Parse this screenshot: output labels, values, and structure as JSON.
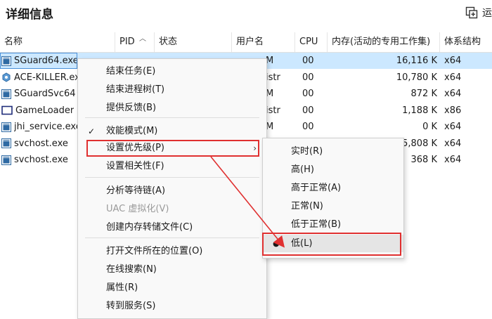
{
  "header": {
    "title": "详细信息",
    "run_label": "运"
  },
  "columns": [
    "名称",
    "PID",
    "状态",
    "用户名",
    "CPU",
    "内存(活动的专用工作集)",
    "体系结构"
  ],
  "rows": [
    {
      "name": "SGuard64.exe",
      "user": "M",
      "cpu": "00",
      "mem": "16,116 K",
      "arch": "x64",
      "icon": "app-window-icon",
      "selected": true
    },
    {
      "name": "ACE-KILLER.exe",
      "user": "istr",
      "cpu": "00",
      "mem": "10,780 K",
      "arch": "x64",
      "icon": "gear-app-icon"
    },
    {
      "name": "SGuardSvc64",
      "user": "M",
      "cpu": "00",
      "mem": "872 K",
      "arch": "x64",
      "icon": "app-window-icon"
    },
    {
      "name": "GameLoader",
      "user": "istr",
      "cpu": "00",
      "mem": "1,188 K",
      "arch": "x86",
      "icon": "window-frame-icon"
    },
    {
      "name": "jhi_service.exe",
      "user": "M",
      "cpu": "00",
      "mem": "0 K",
      "arch": "x64",
      "icon": "app-window-icon"
    },
    {
      "name": "svchost.exe",
      "user": "",
      "cpu": "",
      "mem": "5,808 K",
      "arch": "x64",
      "icon": "app-window-icon"
    },
    {
      "name": "svchost.exe",
      "user": "",
      "cpu": "",
      "mem": "368 K",
      "arch": "x64",
      "icon": "app-window-icon"
    }
  ],
  "context_menu": {
    "items": [
      {
        "label": "结束任务(E)"
      },
      {
        "label": "结束进程树(T)"
      },
      {
        "label": "提供反馈(B)"
      },
      {
        "label": "效能模式(M)",
        "checked": true
      },
      {
        "label": "设置优先级(P)",
        "submenu": true
      },
      {
        "label": "设置相关性(F)"
      },
      {
        "label": "分析等待链(A)"
      },
      {
        "label": "UAC 虚拟化(V)",
        "disabled": true
      },
      {
        "label": "创建内存转储文件(C)"
      },
      {
        "label": "打开文件所在的位置(O)"
      },
      {
        "label": "在线搜索(N)"
      },
      {
        "label": "属性(R)"
      },
      {
        "label": "转到服务(S)"
      }
    ]
  },
  "priority_menu": {
    "items": [
      {
        "label": "实时(R)"
      },
      {
        "label": "高(H)"
      },
      {
        "label": "高于正常(A)"
      },
      {
        "label": "正常(N)"
      },
      {
        "label": "低于正常(B)"
      },
      {
        "label": "低(L)",
        "selected": true
      }
    ]
  },
  "colors": {
    "annotation": "#e03030",
    "selection": "#cce8ff",
    "menu_bg": "#f9f9f9"
  }
}
